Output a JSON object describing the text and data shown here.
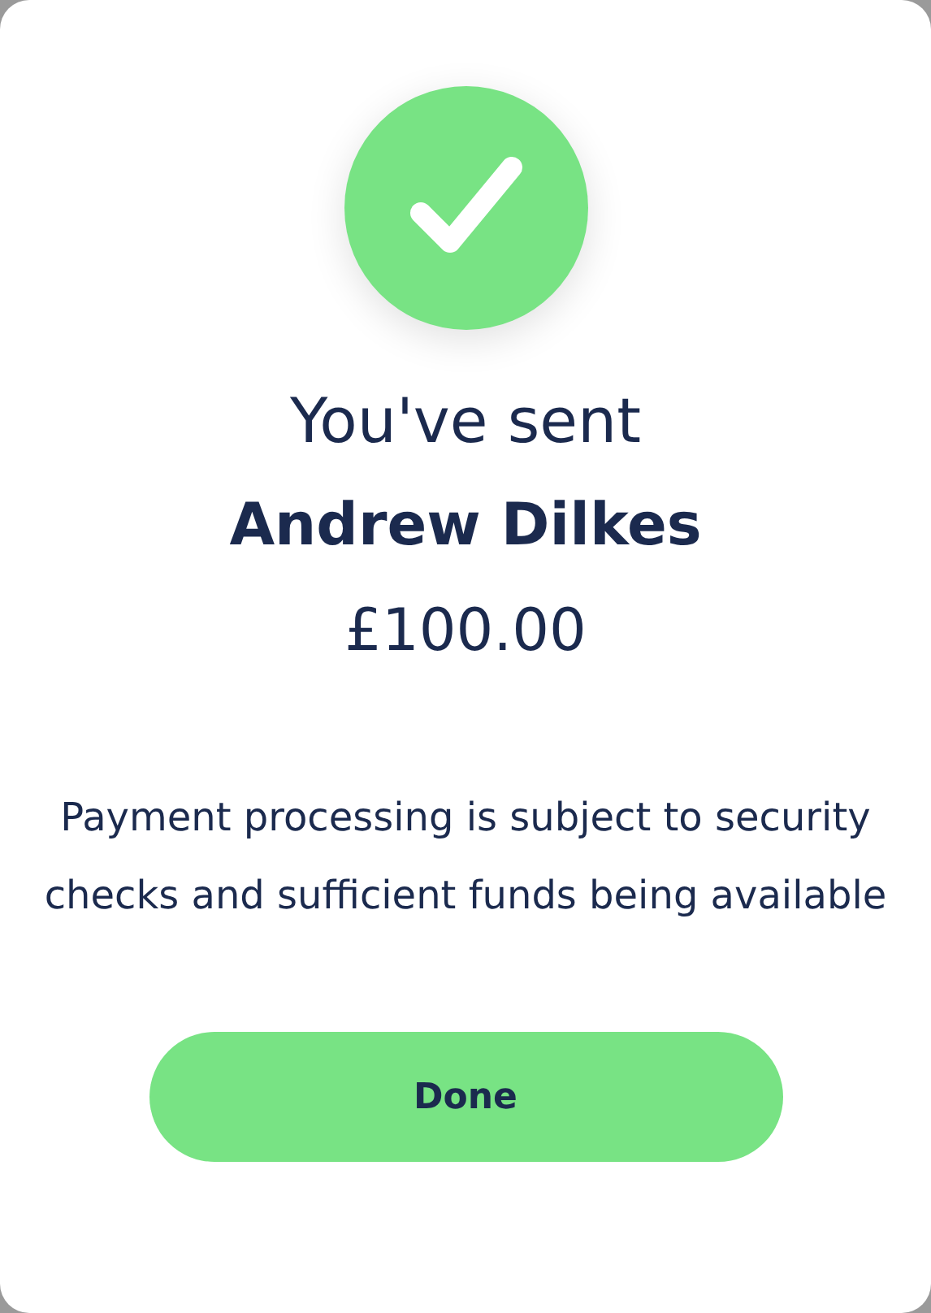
{
  "confirmation": {
    "heading": "You've sent",
    "recipient": "Andrew Dilkes",
    "amount": "£100.00",
    "note": "Payment processing is subject to security checks and sufficient funds being available",
    "button": "Done"
  }
}
